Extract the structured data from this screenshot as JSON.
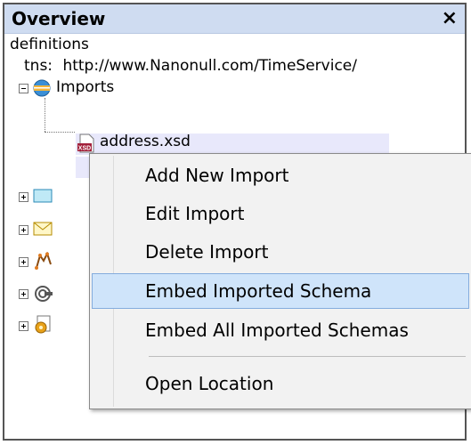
{
  "panel": {
    "title": "Overview",
    "close_glyph": "×"
  },
  "tree": {
    "root_label": "definitions",
    "tns_label": "tns:",
    "tns_value": "http://www.Nanonull.com/TimeService/",
    "imports_label": "Imports",
    "import_file": "address.xsd",
    "xsd_badge": "XSD"
  },
  "context_menu": {
    "items": [
      {
        "label": "Add New Import"
      },
      {
        "label": "Edit Import"
      },
      {
        "label": "Delete Import"
      },
      {
        "label": "Embed Imported Schema"
      },
      {
        "label": "Embed All Imported Schemas"
      },
      {
        "label": "Open Location"
      }
    ],
    "highlighted_item": "Embed Imported Schema"
  }
}
